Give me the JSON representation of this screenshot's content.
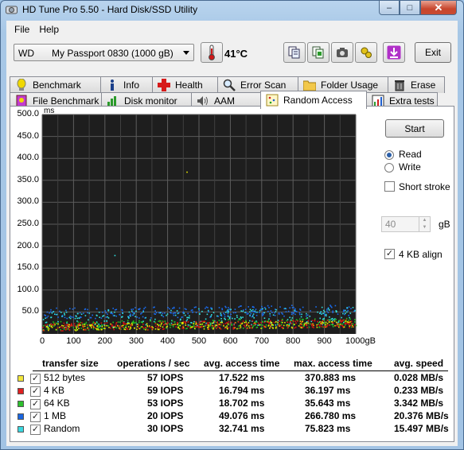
{
  "window": {
    "title": "HD Tune Pro 5.50 - Hard Disk/SSD Utility",
    "caption_buttons": {
      "minimize": "–",
      "maximize": "□",
      "close": "✕"
    }
  },
  "menu": [
    "File",
    "Help"
  ],
  "toolbar": {
    "drive_vendor": "WD",
    "drive_model": "My Passport 0830 (1000 gB)",
    "temperature": "41°C",
    "exit_label": "Exit"
  },
  "tabs": {
    "row_top": [
      "Benchmark",
      "Info",
      "Health",
      "Error Scan",
      "Folder Usage",
      "Erase"
    ],
    "row_bottom": [
      "File Benchmark",
      "Disk monitor",
      "AAM",
      "Random Access",
      "Extra tests"
    ],
    "active": "Random Access"
  },
  "controls": {
    "start_label": "Start",
    "read_label": "Read",
    "write_label": "Write",
    "mode": "Read",
    "short_stroke_label": "Short stroke",
    "short_stroke_checked": false,
    "short_stroke_value": "40",
    "short_stroke_unit": "gB",
    "align_label": "4 KB align",
    "align_checked": true
  },
  "chart_data": {
    "type": "scatter",
    "y_unit": "ms",
    "x_unit_suffix": "gB",
    "ylim": [
      0,
      500
    ],
    "xlim": [
      0,
      1000
    ],
    "y_ticks": [
      "500.0",
      "450.0",
      "400.0",
      "350.0",
      "300.0",
      "250.0",
      "200.0",
      "150.0",
      "100.0",
      "50.0"
    ],
    "x_ticks": [
      "0",
      "100",
      "200",
      "300",
      "400",
      "500",
      "600",
      "700",
      "800",
      "900",
      "1000gB"
    ],
    "grid": true,
    "background": "#1e1e1e",
    "series": [
      {
        "color": "#e8e800",
        "band": [
          8,
          24
        ]
      },
      {
        "color": "#e01010",
        "band": [
          8,
          26
        ]
      },
      {
        "color": "#20c020",
        "band": [
          9,
          30
        ]
      },
      {
        "color": "#1a6cf0",
        "band": [
          35,
          60
        ]
      },
      {
        "color": "#30e0e0",
        "band": [
          15,
          55
        ]
      }
    ]
  },
  "results": {
    "headers": [
      "transfer size",
      "operations / sec",
      "avg. access time",
      "max. access time",
      "avg. speed"
    ],
    "rows": [
      {
        "color": "#f2e63a",
        "checked": true,
        "size": "512 bytes",
        "ops": "57 IOPS",
        "avg": "17.522 ms",
        "max": "370.883 ms",
        "speed": "0.028 MB/s"
      },
      {
        "color": "#e02020",
        "checked": true,
        "size": "4 KB",
        "ops": "59 IOPS",
        "avg": "16.794 ms",
        "max": "36.197 ms",
        "speed": "0.233 MB/s"
      },
      {
        "color": "#2ec02e",
        "checked": true,
        "size": "64 KB",
        "ops": "53 IOPS",
        "avg": "18.702 ms",
        "max": "35.643 ms",
        "speed": "3.342 MB/s"
      },
      {
        "color": "#1a66e0",
        "checked": true,
        "size": "1 MB",
        "ops": "20 IOPS",
        "avg": "49.076 ms",
        "max": "266.780 ms",
        "speed": "20.376 MB/s"
      },
      {
        "color": "#3ad8e0",
        "checked": true,
        "size": "Random",
        "ops": "30 IOPS",
        "avg": "32.741 ms",
        "max": "75.823 ms",
        "speed": "15.497 MB/s"
      }
    ]
  }
}
